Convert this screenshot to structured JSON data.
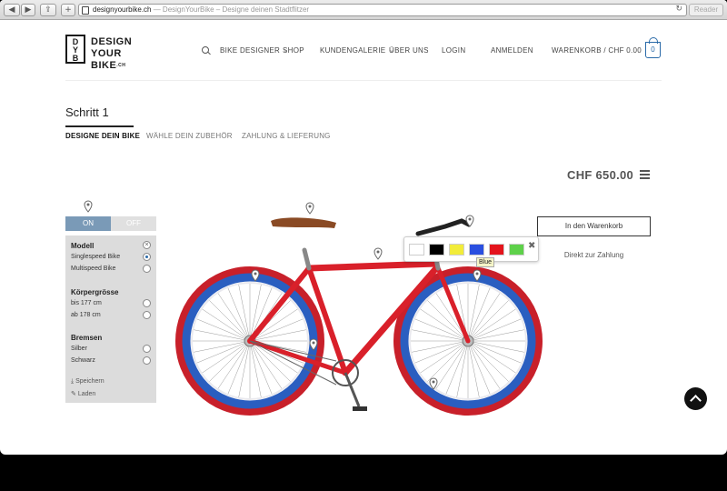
{
  "browser": {
    "url": "designyourbike.ch",
    "page_title": " — DesignYourBike – Designe deinen Stadtflitzer",
    "reader": "Reader"
  },
  "logo": {
    "line1": "DESIGN",
    "line2": "YOUR BIKE",
    "suffix": ".CH",
    "mark": "D Y B"
  },
  "nav": {
    "items": [
      {
        "label": "BIKE DESIGNER"
      },
      {
        "label": "SHOP"
      },
      {
        "label": "KUNDENGALERIE"
      },
      {
        "label": "ÜBER UNS"
      },
      {
        "label": "LOGIN"
      },
      {
        "label": "ANMELDEN"
      },
      {
        "label": "WARENKORB / CHF 0.00"
      }
    ],
    "cart_count": "0"
  },
  "steps": {
    "title": "Schritt 1",
    "tabs": [
      {
        "label": "DESIGNE DEIN BIKE",
        "active": true
      },
      {
        "label": "WÄHLE DEIN ZUBEHÖR"
      },
      {
        "label": "ZAHLUNG & LIEFERUNG"
      }
    ]
  },
  "price": "CHF 650.00",
  "toggle": {
    "on": "ON",
    "off": "OFF"
  },
  "options": {
    "modell": {
      "heading": "Modell",
      "items": [
        {
          "label": "Singlespeed Bike",
          "selected": true
        },
        {
          "label": "Multispeed Bike"
        }
      ]
    },
    "groesse": {
      "heading": "Körpergrösse",
      "items": [
        {
          "label": "bis 177 cm"
        },
        {
          "label": "ab 178 cm"
        }
      ]
    },
    "bremsen": {
      "heading": "Bremsen",
      "items": [
        {
          "label": "Silber"
        },
        {
          "label": "Schwarz"
        }
      ]
    },
    "save": "Speichern",
    "load": "Laden"
  },
  "actions": {
    "add_to_cart": "In den Warenkorb",
    "direct_pay": "Direkt zur Zahlung"
  },
  "palette": {
    "colors": [
      "#ffffff",
      "#000000",
      "#f2ec3a",
      "#2a4fe0",
      "#e4141c",
      "#5ed14a"
    ],
    "tooltip": "Blue"
  },
  "bike_colors": {
    "frame": "#d9202a",
    "rim_outer": "#c8202a",
    "rim_inner": "#2a5ec0",
    "saddle": "#8a4a24"
  }
}
